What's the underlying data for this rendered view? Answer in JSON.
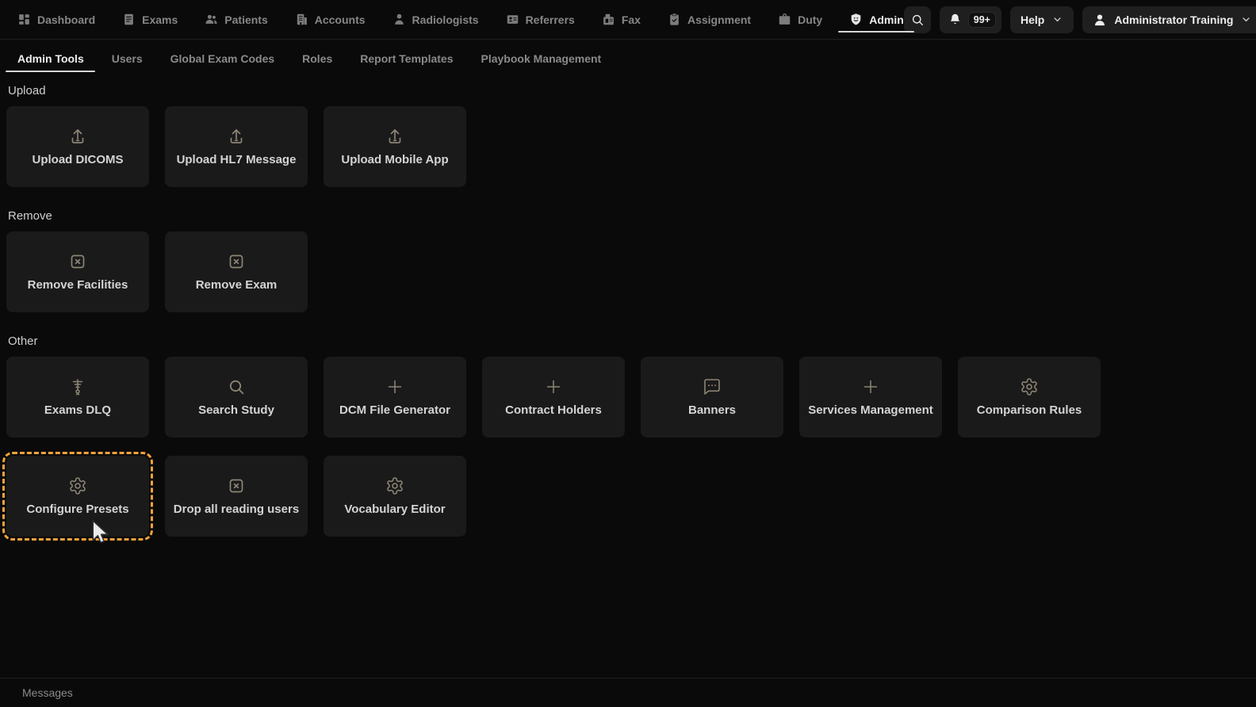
{
  "header": {
    "nav_items": [
      {
        "label": "Dashboard",
        "icon": "dashboard-icon",
        "active": false
      },
      {
        "label": "Exams",
        "icon": "exams-icon",
        "active": false
      },
      {
        "label": "Patients",
        "icon": "patients-icon",
        "active": false
      },
      {
        "label": "Accounts",
        "icon": "accounts-icon",
        "active": false
      },
      {
        "label": "Radiologists",
        "icon": "radiologists-icon",
        "active": false
      },
      {
        "label": "Referrers",
        "icon": "referrers-icon",
        "active": false
      },
      {
        "label": "Fax",
        "icon": "fax-icon",
        "active": false
      },
      {
        "label": "Assignment",
        "icon": "assignment-icon",
        "active": false
      },
      {
        "label": "Duty",
        "icon": "duty-icon",
        "active": false
      },
      {
        "label": "Admin",
        "icon": "admin-icon",
        "active": true
      }
    ],
    "search_icon": "search-icon",
    "bell_icon": "bell-icon",
    "notification_count": "99+",
    "help": {
      "label": "Help",
      "chevron_icon": "chevron-down-icon"
    },
    "user_menu": {
      "label": "Administrator Training",
      "icon": "user-icon",
      "chevron_icon": "chevron-down-icon"
    }
  },
  "tabs": [
    {
      "label": "Admin Tools",
      "active": true
    },
    {
      "label": "Users",
      "active": false
    },
    {
      "label": "Global Exam Codes",
      "active": false
    },
    {
      "label": "Roles",
      "active": false
    },
    {
      "label": "Report Templates",
      "active": false
    },
    {
      "label": "Playbook Management",
      "active": false
    }
  ],
  "sections": [
    {
      "title": "Upload",
      "cards": [
        {
          "label": "Upload DICOMS",
          "icon": "upload-icon"
        },
        {
          "label": "Upload HL7 Message",
          "icon": "upload-icon"
        },
        {
          "label": "Upload Mobile App",
          "icon": "upload-icon"
        }
      ]
    },
    {
      "title": "Remove",
      "cards": [
        {
          "label": "Remove Facilities",
          "icon": "square-x-icon"
        },
        {
          "label": "Remove Exam",
          "icon": "square-x-icon"
        }
      ]
    },
    {
      "title": "Other",
      "cards": [
        {
          "label": "Exams DLQ",
          "icon": "dlq-icon"
        },
        {
          "label": "Search Study",
          "icon": "search-icon"
        },
        {
          "label": "DCM File Generator",
          "icon": "plus-icon"
        },
        {
          "label": "Contract Holders",
          "icon": "plus-icon"
        },
        {
          "label": "Banners",
          "icon": "banner-icon"
        },
        {
          "label": "Services Management",
          "icon": "plus-icon"
        },
        {
          "label": "Comparison Rules",
          "icon": "gear-icon"
        },
        {
          "label": "Configure Presets",
          "icon": "gear-icon",
          "highlighted": true
        },
        {
          "label": "Drop all reading users",
          "icon": "square-x-icon"
        },
        {
          "label": "Vocabulary Editor",
          "icon": "gear-icon"
        }
      ]
    }
  ],
  "footer": {
    "label": "Messages"
  },
  "colors": {
    "page_bg": "#0a0a0a",
    "card_bg": "#1a1a1a",
    "accent_highlight": "#f2a23c",
    "active_text": "#ededed",
    "muted_text": "#8a8a8a"
  }
}
